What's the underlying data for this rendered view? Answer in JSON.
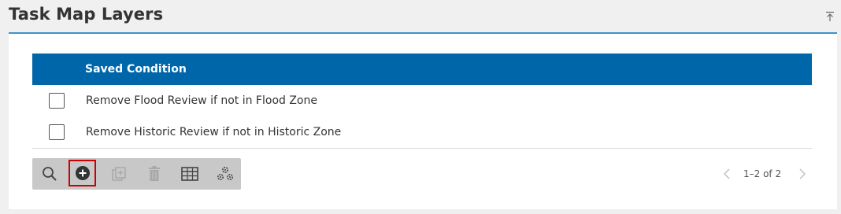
{
  "panel": {
    "title": "Task Map Layers",
    "collapse_icon": "collapse-up-icon"
  },
  "grid": {
    "columns": [
      "Saved Condition"
    ],
    "rows": [
      {
        "checked": false,
        "condition": "Remove Flood Review if not in Flood Zone"
      },
      {
        "checked": false,
        "condition": "Remove Historic Review if not in Historic Zone"
      }
    ]
  },
  "toolbar": {
    "buttons": [
      {
        "icon": "search-icon",
        "enabled": true
      },
      {
        "icon": "add-circle-icon",
        "enabled": true,
        "highlighted": true
      },
      {
        "icon": "copy-icon",
        "enabled": false
      },
      {
        "icon": "delete-icon",
        "enabled": false
      },
      {
        "icon": "table-icon",
        "enabled": true
      },
      {
        "icon": "settings-icon",
        "enabled": true
      }
    ]
  },
  "pager": {
    "text": "1–2 of 2",
    "prev_enabled": false,
    "next_enabled": false
  },
  "colors": {
    "header_bg": "#0066aa",
    "title_underline": "#3a95c8",
    "highlight_border": "#cc0000"
  }
}
